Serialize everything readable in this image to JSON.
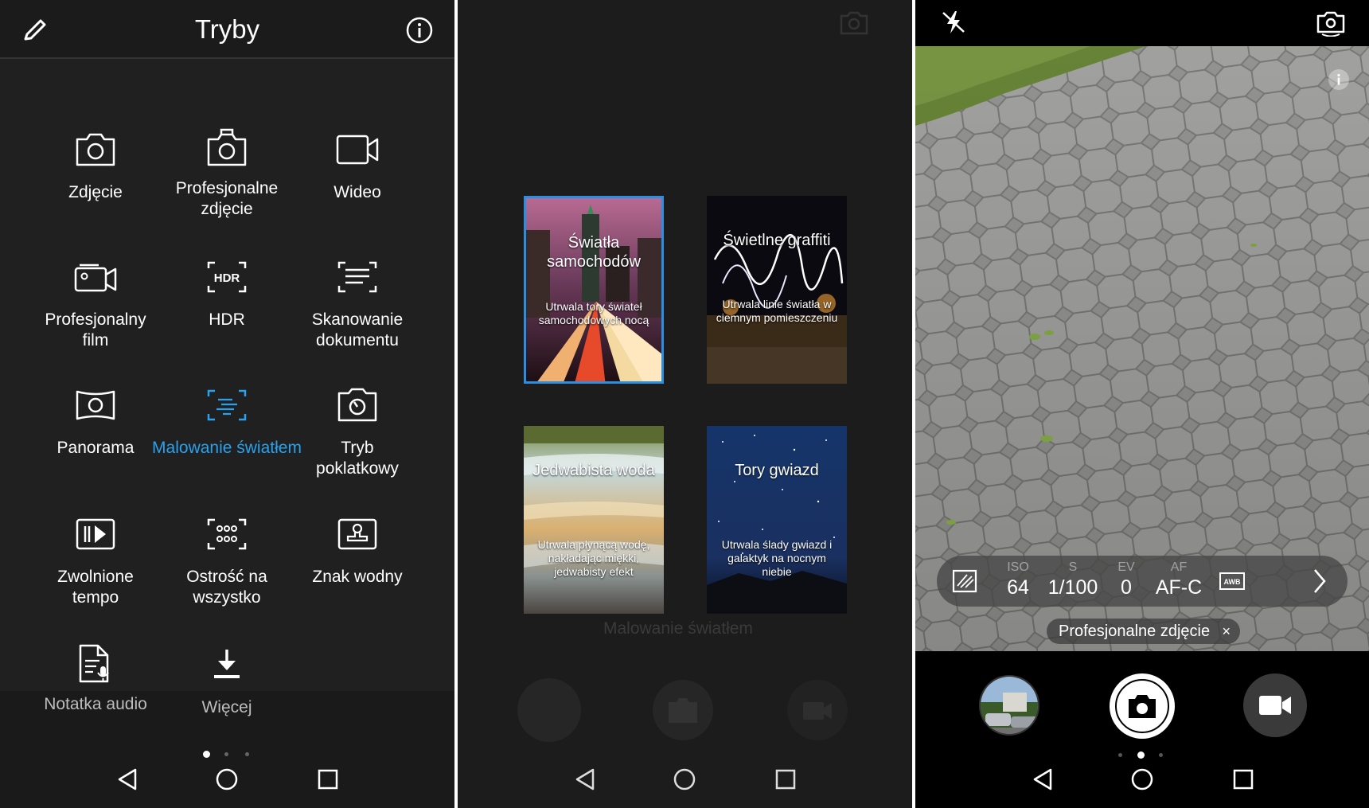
{
  "modes_screen": {
    "title": "Tryby",
    "icons": {
      "edit": "pencil-icon",
      "info": "info-icon"
    },
    "modes": [
      {
        "label": "Zdjęcie",
        "icon": "camera-icon"
      },
      {
        "label": "Profesjonalne\nzdjęcie",
        "icon": "pro-camera-icon"
      },
      {
        "label": "Wideo",
        "icon": "video-icon"
      },
      {
        "label": "Profesjonalny\nfilm",
        "icon": "pro-video-icon"
      },
      {
        "label": "HDR",
        "icon": "hdr-icon"
      },
      {
        "label": "Skanowanie\ndokumentu",
        "icon": "document-scan-icon"
      },
      {
        "label": "Panorama",
        "icon": "panorama-icon"
      },
      {
        "label": "Malowanie światłem",
        "icon": "light-painting-icon",
        "active": true
      },
      {
        "label": "Tryb\npoklatkowy",
        "icon": "time-lapse-icon"
      },
      {
        "label": "Zwolnione\ntempo",
        "icon": "slow-motion-icon"
      },
      {
        "label": "Ostrość na wszystko",
        "icon": "all-focus-icon"
      },
      {
        "label": "Znak wodny",
        "icon": "watermark-icon"
      },
      {
        "label": "Notatka audio",
        "icon": "audio-note-icon"
      },
      {
        "label": "Więcej",
        "icon": "download-icon"
      }
    ],
    "active_color": "#2aa1ec"
  },
  "light_painting_screen": {
    "cards": [
      {
        "title": "Światła samochodów",
        "description": "Utrwala tory świateł samochodowych nocą",
        "selected": true
      },
      {
        "title": "Świetlne graffiti",
        "description": "Utrwala linie światła w ciemnym pomieszczeniu"
      },
      {
        "title": "Jedwabista woda",
        "description": "Utrwala płynącą wodę, nakładając miękki, jedwabisty efekt"
      },
      {
        "title": "Tory gwiazd",
        "description": "Utrwala ślady gwiazd i galaktyk na nocnym niebie"
      }
    ],
    "background_mode_label": "Malowanie światłem",
    "selection_color": "#2a8fe0"
  },
  "pro_camera_screen": {
    "icons": {
      "flash": "flash-off-icon",
      "switch": "switch-camera-icon",
      "info": "info-icon"
    },
    "params": [
      {
        "name": "ISO",
        "value": "64"
      },
      {
        "name": "S",
        "value": "1/100"
      },
      {
        "name": "EV",
        "value": "0"
      },
      {
        "name": "AF",
        "value": "AF-C"
      }
    ],
    "mode_chip": "Profesjonalne zdjęcie",
    "chip_close": "×"
  },
  "nav": {
    "back": "back-icon",
    "home": "home-icon",
    "recents": "recents-icon"
  }
}
